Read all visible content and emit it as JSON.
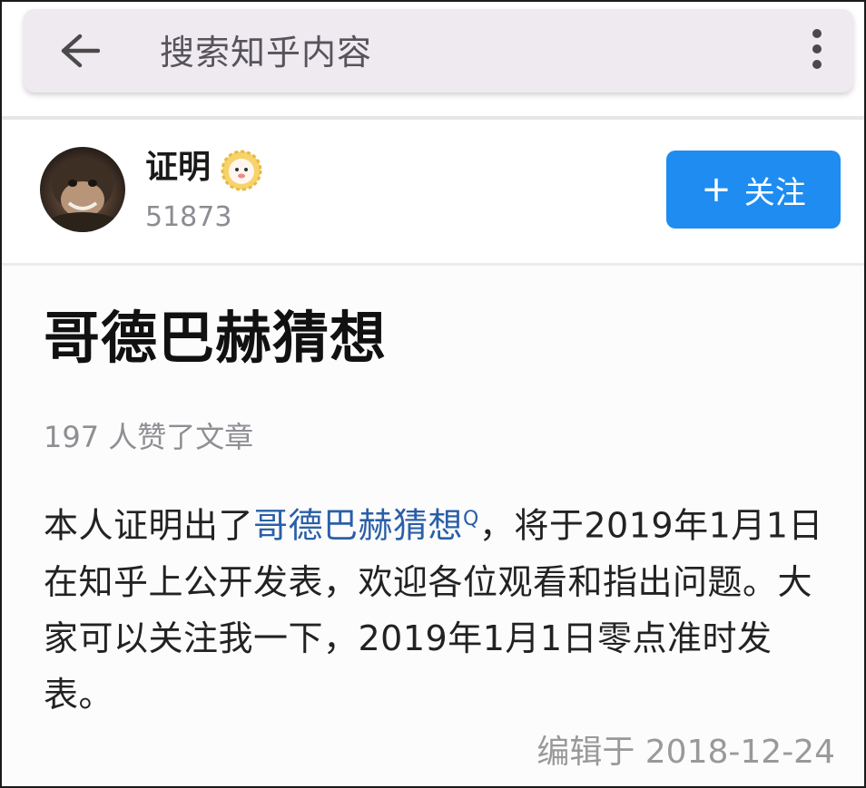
{
  "search_bar": {
    "placeholder": "搜索知乎内容",
    "back_icon": "arrow-left-icon",
    "more_icon": "more-vertical-icon"
  },
  "author": {
    "name": "证明",
    "badge_icon": "emoji-badge-icon",
    "count": "51873",
    "follow_label": "关注",
    "follow_icon": "plus-icon"
  },
  "article": {
    "title": "哥德巴赫猜想",
    "likes": "197 人赞了文章",
    "body_part1": "本人证明出了",
    "body_link": "哥德巴赫猜想",
    "body_link_mark": "Q",
    "body_part2": "，将于2019年1月1日在知乎上公开发表，欢迎各位观看和指出问题。大家可以关注我一下，2019年1月1日零点准时发表。",
    "edit_time": "编辑于 2018-12-24"
  },
  "colors": {
    "accent": "#1e8cf0",
    "link": "#2a5fa8",
    "search_bg": "#efeaf0"
  }
}
